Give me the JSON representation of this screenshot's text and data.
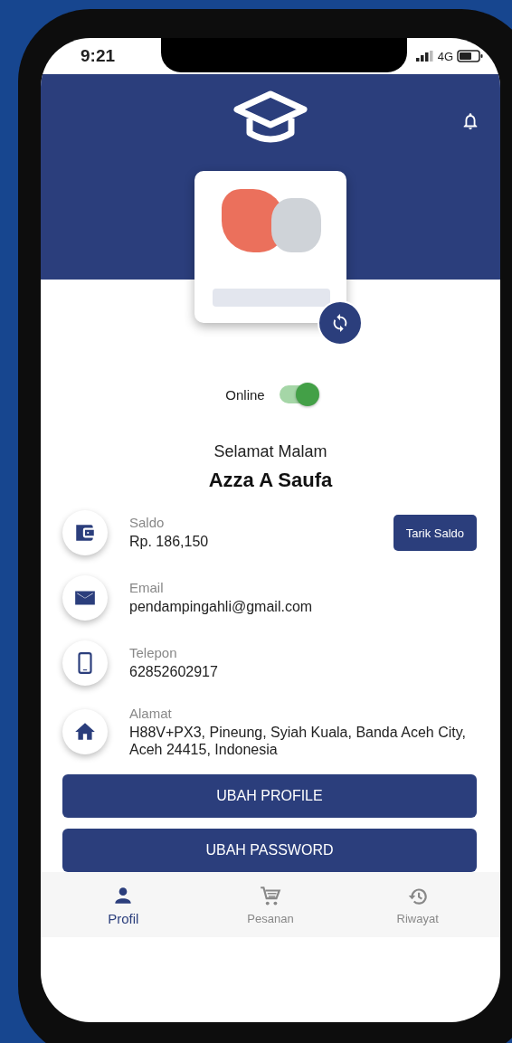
{
  "status_bar": {
    "time": "9:21",
    "network": "4G"
  },
  "status": {
    "label": "Online",
    "on": true
  },
  "greeting": "Selamat Malam",
  "name": "Azza A Saufa",
  "info": [
    {
      "kind": "wallet",
      "label": "Saldo",
      "value": "Rp. 186,150",
      "action": "Tarik Saldo"
    },
    {
      "kind": "email",
      "label": "Email",
      "value": "pendampingahli@gmail.com"
    },
    {
      "kind": "phone",
      "label": "Telepon",
      "value": "62852602917"
    },
    {
      "kind": "home",
      "label": "Alamat",
      "value": "H88V+PX3, Pineung, Syiah Kuala, Banda Aceh City, Aceh 24415, Indonesia"
    }
  ],
  "buttons": [
    "UBAH PROFILE",
    "UBAH PASSWORD"
  ],
  "nav": [
    {
      "kind": "person",
      "label": "Profil",
      "selected": true
    },
    {
      "kind": "cart",
      "label": "Pesanan",
      "selected": false
    },
    {
      "kind": "history",
      "label": "Riwayat",
      "selected": false
    }
  ]
}
